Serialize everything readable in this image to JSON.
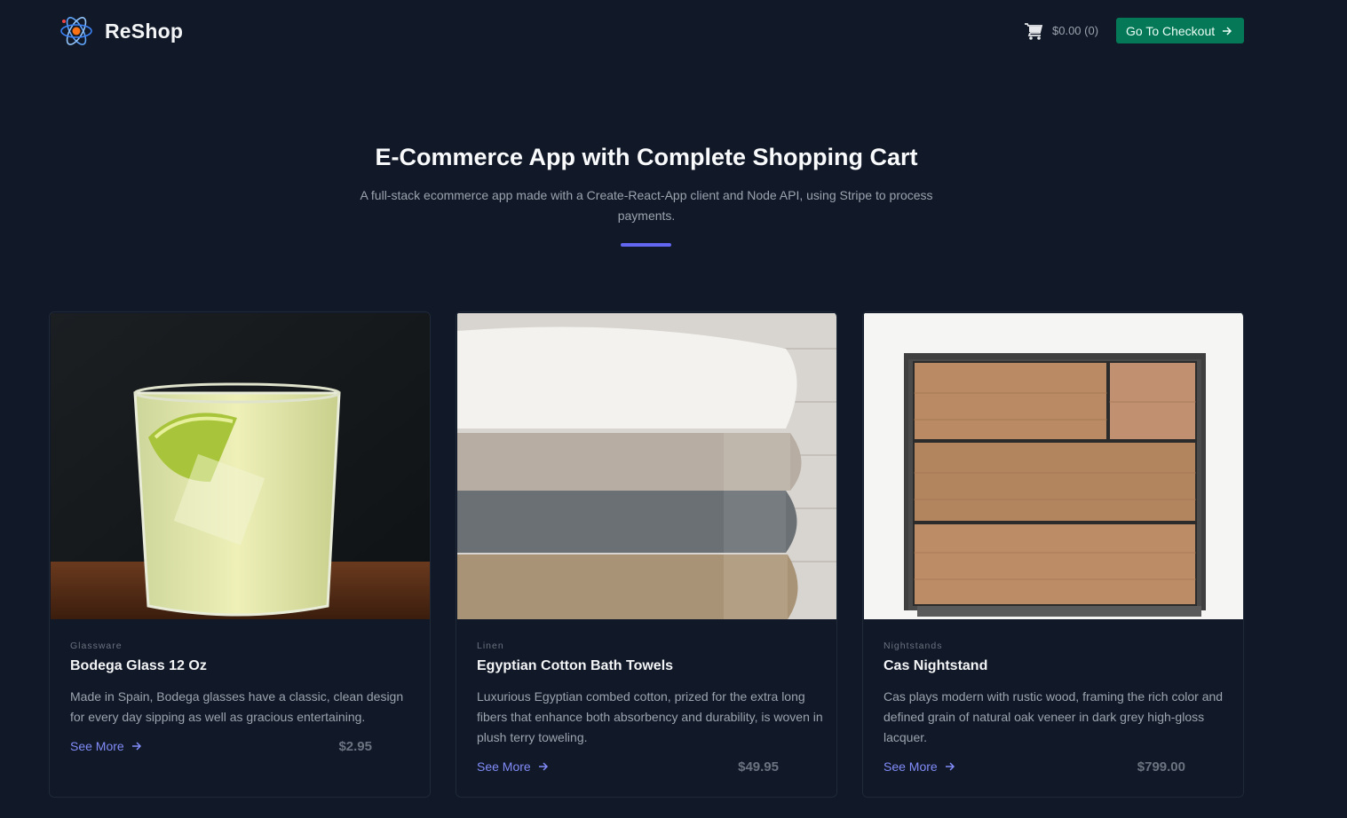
{
  "header": {
    "brand": "ReShop",
    "cart_total": "$0.00 (0)",
    "checkout_label": "Go To Checkout"
  },
  "hero": {
    "title": "E-Commerce App with Complete Shopping Cart",
    "subtitle": "A full-stack ecommerce app made with a Create-React-App client and Node API, using Stripe to process payments."
  },
  "colors": {
    "background": "#111827",
    "accent": "#6366f1",
    "checkout_button": "#047857"
  },
  "products": [
    {
      "category": "Glassware",
      "title": "Bodega Glass 12 Oz",
      "description": "Made in Spain, Bodega glasses have a classic, clean design for every day sipping as well as gracious entertaining.",
      "link": "See More",
      "price": "$2.95",
      "image_icon": "lemonade-glass-image"
    },
    {
      "category": "Linen",
      "title": "Egyptian Cotton Bath Towels",
      "description": "Luxurious Egyptian combed cotton, prized for the extra long fibers that enhance both absorbency and durability, is woven in plush terry toweling.",
      "link": "See More",
      "price": "$49.95",
      "image_icon": "towel-stack-image"
    },
    {
      "category": "Nightstands",
      "title": "Cas Nightstand",
      "description": "Cas plays modern with rustic wood, framing the rich color and defined grain of natural oak veneer in dark grey high-gloss lacquer.",
      "link": "See More",
      "price": "$799.00",
      "image_icon": "wooden-nightstand-image"
    }
  ]
}
